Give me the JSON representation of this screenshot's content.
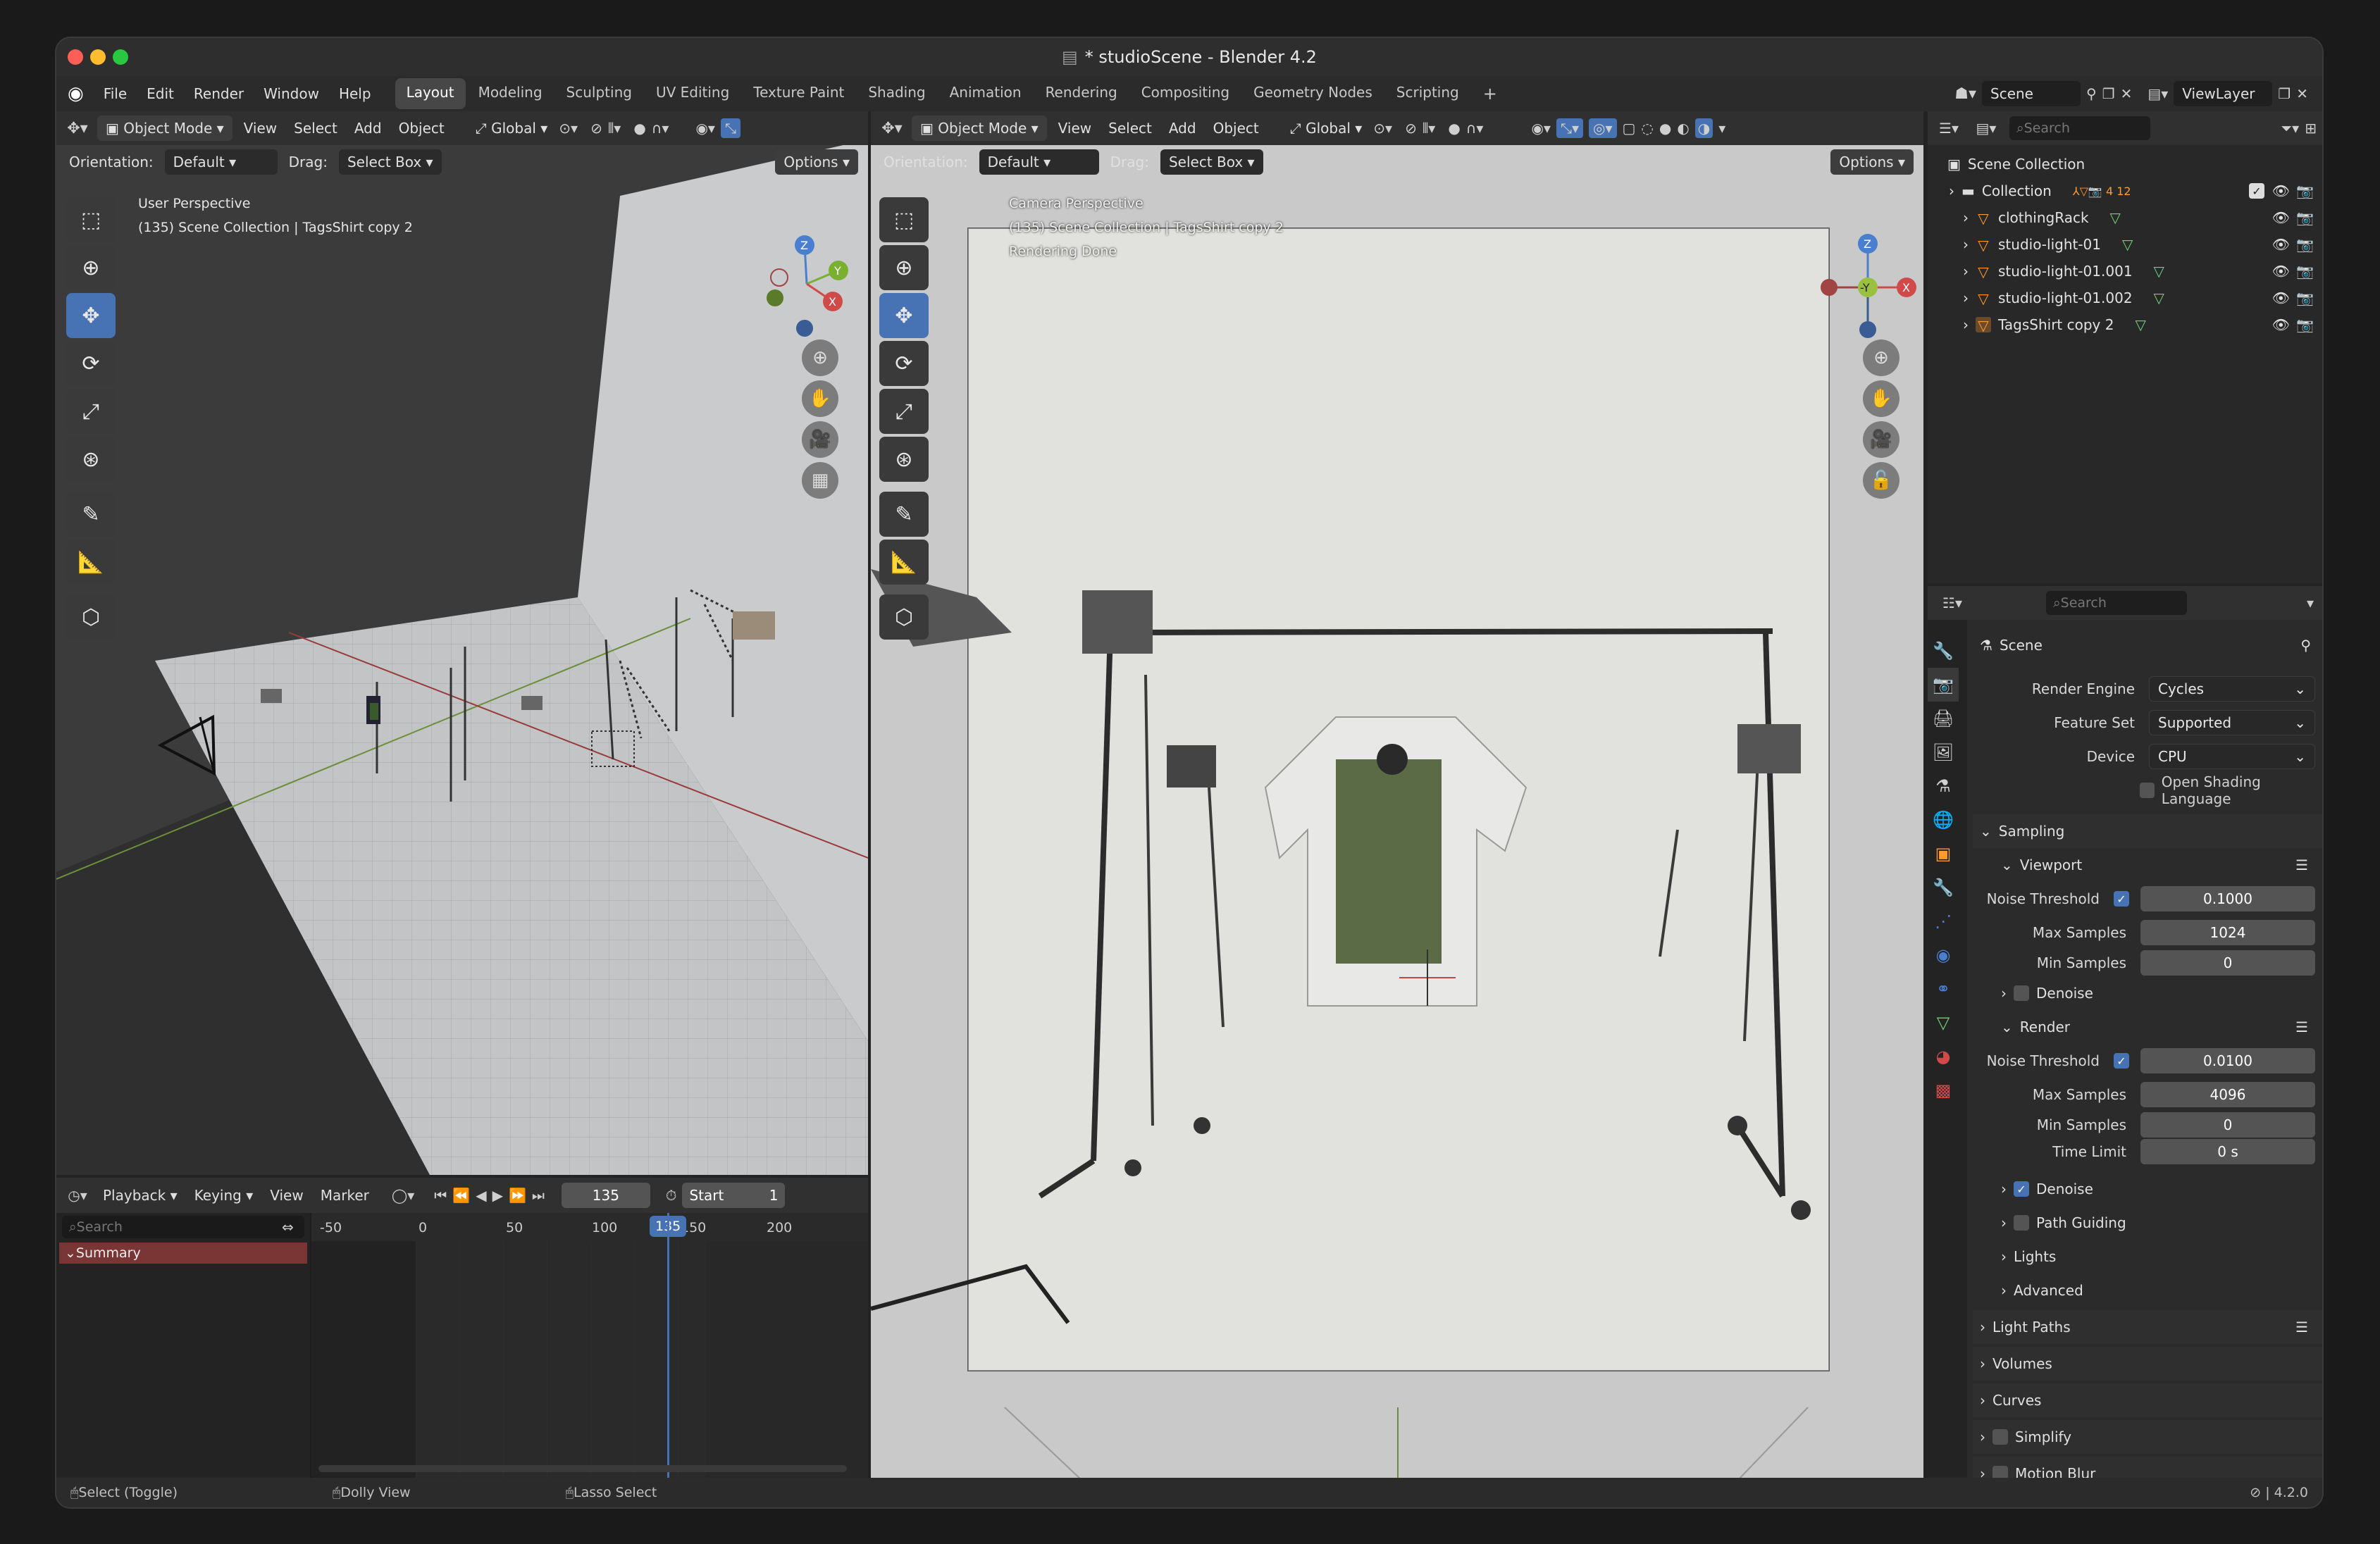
{
  "window": {
    "title": "* studioScene - Blender 4.2"
  },
  "menu": {
    "items": [
      "File",
      "Edit",
      "Render",
      "Window",
      "Help"
    ]
  },
  "workspaces": [
    "Layout",
    "Modeling",
    "Sculpting",
    "UV Editing",
    "Texture Paint",
    "Shading",
    "Animation",
    "Rendering",
    "Compositing",
    "Geometry Nodes",
    "Scripting"
  ],
  "scene_selector": {
    "scene": "Scene",
    "view_layer": "ViewLayer"
  },
  "left_viewport": {
    "mode": "Object Mode",
    "menus": [
      "View",
      "Select",
      "Add",
      "Object"
    ],
    "transform": "Global",
    "orientation_label": "Orientation:",
    "orientation_value": "Default",
    "drag_label": "Drag:",
    "drag_value": "Select Box",
    "options": "Options",
    "overlay_line1": "User Perspective",
    "overlay_line2": "(135) Scene Collection | TagsShirt copy 2"
  },
  "right_viewport": {
    "mode": "Object Mode",
    "menus": [
      "View",
      "Select",
      "Add",
      "Object"
    ],
    "transform": "Global",
    "orientation_label": "Orientation:",
    "orientation_value": "Default",
    "drag_label": "Drag:",
    "drag_value": "Select Box",
    "options": "Options",
    "overlay_line1": "Camera Perspective",
    "overlay_line2": "(135) Scene Collection | TagsShirt copy 2",
    "overlay_line3": "Rendering Done"
  },
  "timeline": {
    "menus": [
      "Playback",
      "Keying",
      "View",
      "Marker"
    ],
    "current_frame": "135",
    "start_label": "Start",
    "start_value": "1",
    "search_placeholder": "Search",
    "ruler": [
      "-50",
      "0",
      "50",
      "100",
      "150",
      "200"
    ],
    "playhead": "135",
    "summary": "Summary"
  },
  "outliner": {
    "search_placeholder": "Search",
    "root": "Scene Collection",
    "items": [
      "Collection",
      "clothingRack",
      "studio-light-01",
      "studio-light-01.001",
      "studio-light-01.002",
      "TagsShirt copy 2"
    ],
    "collection_badge": "4 12"
  },
  "properties": {
    "search_placeholder": "Search",
    "context": "Scene",
    "render_engine_label": "Render Engine",
    "render_engine": "Cycles",
    "feature_set_label": "Feature Set",
    "feature_set": "Supported",
    "device_label": "Device",
    "device": "CPU",
    "osl_label": "Open Shading Language",
    "sampling": "Sampling",
    "viewport": "Viewport",
    "noise_threshold_label": "Noise Threshold",
    "viewport_noise": "0.1000",
    "max_samples_label": "Max Samples",
    "viewport_max": "1024",
    "min_samples_label": "Min Samples",
    "viewport_min": "0",
    "denoise": "Denoise",
    "render": "Render",
    "render_noise": "0.0100",
    "render_max": "4096",
    "render_min": "0",
    "time_limit_label": "Time Limit",
    "time_limit": "0 s",
    "path_guiding": "Path Guiding",
    "lights": "Lights",
    "advanced": "Advanced",
    "light_paths": "Light Paths",
    "volumes": "Volumes",
    "curves": "Curves",
    "simplify": "Simplify",
    "motion_blur": "Motion Blur"
  },
  "statusbar": {
    "select": "Select (Toggle)",
    "dolly": "Dolly View",
    "lasso": "Lasso Select",
    "version": "4.2.0"
  }
}
